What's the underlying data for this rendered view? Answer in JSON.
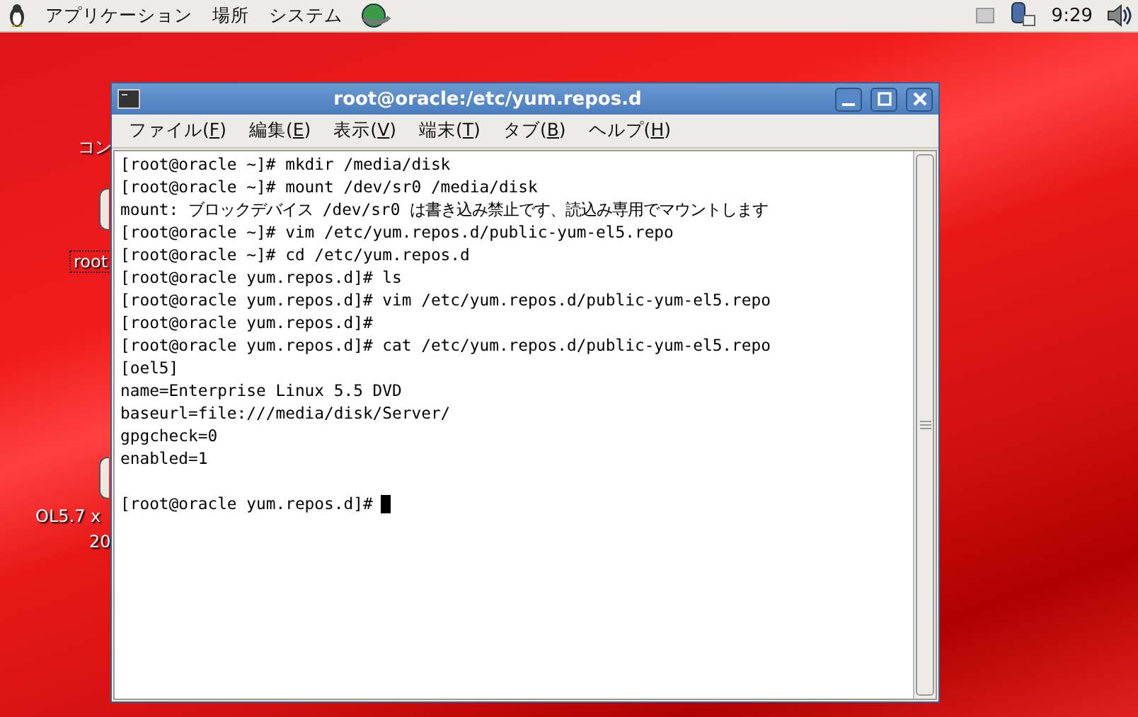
{
  "panel": {
    "menus": [
      "アプリケーション",
      "場所",
      "システム"
    ],
    "clock": "9:29"
  },
  "desktop_icons": [
    {
      "label": "コン",
      "selected": false
    },
    {
      "label": "root",
      "selected": true
    },
    {
      "label": "OL5.7 x",
      "selected": false
    },
    {
      "label": "20",
      "selected": false
    }
  ],
  "window": {
    "title": "root@oracle:/etc/yum.repos.d",
    "menu": [
      {
        "before": "ファイル(",
        "mnemonic": "F",
        "after": ")"
      },
      {
        "before": "編集(",
        "mnemonic": "E",
        "after": ")"
      },
      {
        "before": "表示(",
        "mnemonic": "V",
        "after": ")"
      },
      {
        "before": "端末(",
        "mnemonic": "T",
        "after": ")"
      },
      {
        "before": "タブ(",
        "mnemonic": "B",
        "after": ")"
      },
      {
        "before": "ヘルプ(",
        "mnemonic": "H",
        "after": ")"
      }
    ],
    "terminal": [
      {
        "kind": "text",
        "text": "[root@oracle ~]# mkdir /media/disk"
      },
      {
        "kind": "text",
        "text": "[root@oracle ~]# mount /dev/sr0 /media/disk"
      },
      {
        "kind": "text",
        "text": "mount: ブロックデバイス /dev/sr0 は書き込み禁止です、読込み専用でマウントします"
      },
      {
        "kind": "text",
        "text": "[root@oracle ~]# vim /etc/yum.repos.d/public-yum-el5.repo"
      },
      {
        "kind": "text",
        "text": "[root@oracle ~]# cd /etc/yum.repos.d"
      },
      {
        "kind": "text",
        "text": "[root@oracle yum.repos.d]# ls"
      },
      {
        "kind": "text",
        "text": "[root@oracle yum.repos.d]# vim /etc/yum.repos.d/public-yum-el5.repo"
      },
      {
        "kind": "text",
        "text": "[root@oracle yum.repos.d]#"
      },
      {
        "kind": "text",
        "text": "[root@oracle yum.repos.d]# cat /etc/yum.repos.d/public-yum-el5.repo"
      },
      {
        "kind": "text",
        "text": "[oel5]"
      },
      {
        "kind": "text",
        "text": "name=Enterprise Linux 5.5 DVD"
      },
      {
        "kind": "text",
        "text": "baseurl=file:///media/disk/Server/"
      },
      {
        "kind": "text",
        "text": "gpgcheck=0"
      },
      {
        "kind": "text",
        "text": "enabled=1"
      },
      {
        "kind": "blank"
      },
      {
        "kind": "prompt",
        "text": "[root@oracle yum.repos.d]#"
      }
    ]
  }
}
